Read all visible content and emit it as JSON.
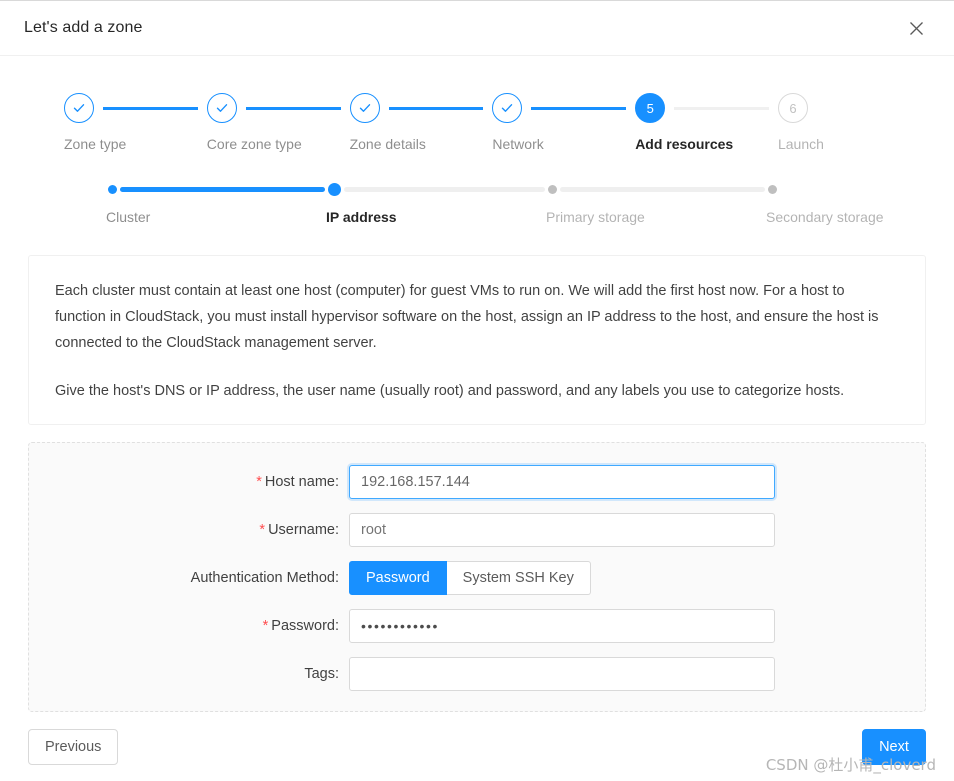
{
  "header": {
    "title": "Let's add a zone",
    "close_icon": "close-icon"
  },
  "steps": [
    {
      "label": "Zone type",
      "state": "finish",
      "marker": "check"
    },
    {
      "label": "Core zone type",
      "state": "finish",
      "marker": "check"
    },
    {
      "label": "Zone details",
      "state": "finish",
      "marker": "check"
    },
    {
      "label": "Network",
      "state": "finish",
      "marker": "check"
    },
    {
      "label": "Add resources",
      "state": "current",
      "marker": "5"
    },
    {
      "label": "Launch",
      "state": "wait",
      "marker": "6"
    }
  ],
  "substeps": [
    {
      "label": "Cluster",
      "state": "finish"
    },
    {
      "label": "IP address",
      "state": "current"
    },
    {
      "label": "Primary storage",
      "state": "wait"
    },
    {
      "label": "Secondary storage",
      "state": "wait"
    }
  ],
  "info": {
    "paragraph1": "Each cluster must contain at least one host (computer) for guest VMs to run on. We will add the first host now. For a host to function in CloudStack, you must install hypervisor software on the host, assign an IP address to the host, and ensure the host is connected to the CloudStack management server.",
    "paragraph2": "Give the host's DNS or IP address, the user name (usually root) and password, and any labels you use to categorize hosts."
  },
  "form": {
    "required_mark": "*",
    "host_name": {
      "label": "Host name:",
      "value": "192.168.157.144",
      "placeholder": "",
      "required": true
    },
    "username": {
      "label": "Username:",
      "value": "root",
      "placeholder": "",
      "required": true
    },
    "auth_method": {
      "label": "Authentication Method:",
      "options": [
        "Password",
        "System SSH Key"
      ],
      "selected": "Password"
    },
    "password": {
      "label": "Password:",
      "value": "••••••••••••",
      "placeholder": "",
      "required": true
    },
    "tags": {
      "label": "Tags:",
      "value": "",
      "placeholder": "",
      "required": false
    }
  },
  "footer": {
    "previous_label": "Previous",
    "next_label": "Next"
  },
  "watermark": "CSDN @杜小甫_cloverd",
  "colors": {
    "primary": "#1890ff",
    "focus_border": "#40a9ff",
    "required_red": "#ff4d4f",
    "inactive_line": "#f0f0f0",
    "inactive_dot": "#bfbfbf",
    "card_bg": "#fafafa"
  }
}
